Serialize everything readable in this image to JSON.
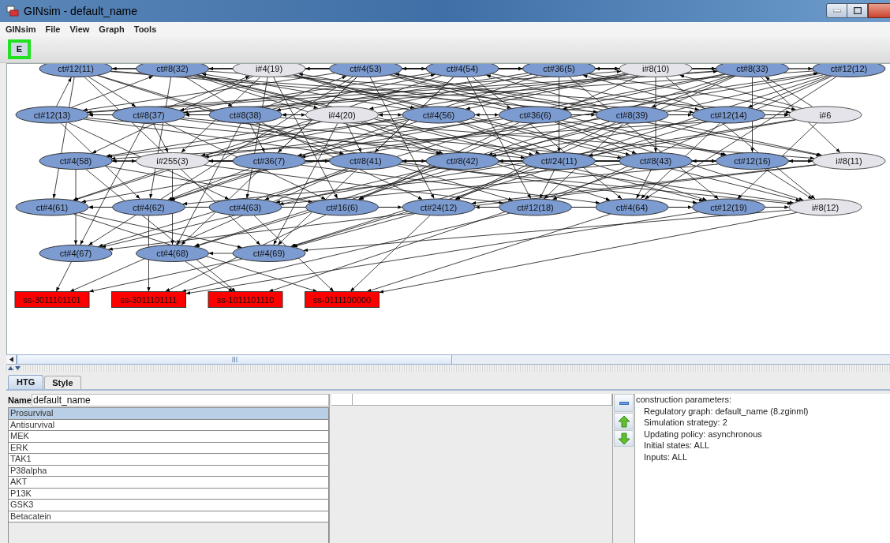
{
  "window": {
    "title": "GINsim - default_name"
  },
  "menu": [
    "GINsim",
    "File",
    "View",
    "Graph",
    "Tools"
  ],
  "toolbar": [
    {
      "label": "E",
      "selected": true
    }
  ],
  "graph": {
    "rows": [
      [
        {
          "label": "ct#12(11)",
          "kind": "ct"
        },
        {
          "label": "ct#8(32)",
          "kind": "ct"
        },
        {
          "label": "i#4(19)",
          "kind": "i"
        },
        {
          "label": "ct#4(53)",
          "kind": "ct"
        },
        {
          "label": "ct#4(54)",
          "kind": "ct"
        },
        {
          "label": "ct#36(5)",
          "kind": "ct"
        },
        {
          "label": "i#8(10)",
          "kind": "i"
        },
        {
          "label": "ct#8(33)",
          "kind": "ct"
        },
        {
          "label": "ct#12(12)",
          "kind": "ct"
        }
      ],
      [
        {
          "label": "ct#12(13)",
          "kind": "ct"
        },
        {
          "label": "ct#8(37)",
          "kind": "ct"
        },
        {
          "label": "ct#8(38)",
          "kind": "ct"
        },
        {
          "label": "i#4(20)",
          "kind": "i"
        },
        {
          "label": "ct#4(56)",
          "kind": "ct"
        },
        {
          "label": "ct#36(6)",
          "kind": "ct"
        },
        {
          "label": "ct#8(39)",
          "kind": "ct"
        },
        {
          "label": "ct#12(14)",
          "kind": "ct"
        },
        {
          "label": "i#6",
          "kind": "i"
        }
      ],
      [
        {
          "label": "ct#4(58)",
          "kind": "ct"
        },
        {
          "label": "i#255(3)",
          "kind": "i"
        },
        {
          "label": "ct#36(7)",
          "kind": "ct"
        },
        {
          "label": "ct#8(41)",
          "kind": "ct"
        },
        {
          "label": "ct#8(42)",
          "kind": "ct"
        },
        {
          "label": "ct#24(11)",
          "kind": "ct"
        },
        {
          "label": "ct#8(43)",
          "kind": "ct"
        },
        {
          "label": "ct#12(16)",
          "kind": "ct"
        },
        {
          "label": "i#8(11)",
          "kind": "i"
        }
      ],
      [
        {
          "label": "ct#4(61)",
          "kind": "ct"
        },
        {
          "label": "ct#4(62)",
          "kind": "ct"
        },
        {
          "label": "ct#4(63)",
          "kind": "ct"
        },
        {
          "label": "ct#16(6)",
          "kind": "ct"
        },
        {
          "label": "ct#24(12)",
          "kind": "ct"
        },
        {
          "label": "ct#12(18)",
          "kind": "ct"
        },
        {
          "label": "ct#4(64)",
          "kind": "ct"
        },
        {
          "label": "ct#12(19)",
          "kind": "ct"
        },
        {
          "label": "i#8(12)",
          "kind": "i"
        }
      ],
      [
        {
          "label": "ct#4(67)",
          "kind": "ct"
        },
        {
          "label": "ct#4(68)",
          "kind": "ct"
        },
        {
          "label": "ct#4(69)",
          "kind": "ct"
        }
      ],
      [
        {
          "label": "ss-3011101101",
          "kind": "ss"
        },
        {
          "label": "ss-3011101111",
          "kind": "ss"
        },
        {
          "label": "ss-1011101110",
          "kind": "ss"
        },
        {
          "label": "ss-0111100000",
          "kind": "ss"
        }
      ]
    ]
  },
  "tabs": [
    {
      "label": "HTG",
      "selected": true
    },
    {
      "label": "Style",
      "selected": false
    }
  ],
  "name_field": {
    "label": "Name",
    "value": "default_name"
  },
  "components": [
    {
      "label": "Prosurvival",
      "selected": true
    },
    {
      "label": "Antisurvival",
      "selected": false
    },
    {
      "label": "MEK",
      "selected": false
    },
    {
      "label": "ERK",
      "selected": false
    },
    {
      "label": "TAK1",
      "selected": false
    },
    {
      "label": "P38alpha",
      "selected": false
    },
    {
      "label": "AKT",
      "selected": false
    },
    {
      "label": "P13K",
      "selected": false
    },
    {
      "label": "GSK3",
      "selected": false
    },
    {
      "label": "Betacatein",
      "selected": false
    }
  ],
  "info": {
    "heading": "construction parameters:",
    "lines": [
      "Regulatory graph: default_name (8.zginml)",
      "Simulation strategy: 2",
      "Updating policy: asynchronous",
      "Initial states: ALL",
      "Inputs: ALL"
    ]
  }
}
